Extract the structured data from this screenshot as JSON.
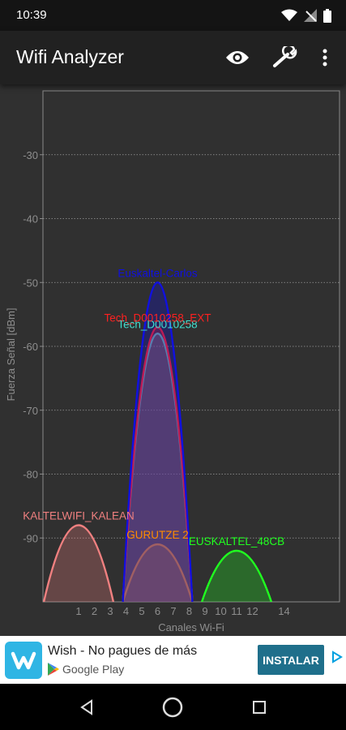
{
  "status_bar": {
    "time": "10:39"
  },
  "app_bar": {
    "title": "Wifi Analyzer",
    "icons": [
      "eye-icon",
      "wrench-icon",
      "more-vert-icon"
    ]
  },
  "chart_data": {
    "type": "area",
    "ylabel": "Fuerza Señal [dBm]",
    "xlabel": "Canales Wi-Fi",
    "ylim": [
      -100,
      -20
    ],
    "yticks": [
      -30,
      -40,
      -50,
      -60,
      -70,
      -80,
      -90
    ],
    "xticks": [
      1,
      2,
      3,
      4,
      5,
      6,
      7,
      8,
      9,
      10,
      11,
      12,
      14
    ],
    "grid": true,
    "networks": [
      {
        "ssid": "KALTELWIFI_KALEAN",
        "channel": 1,
        "signal": -88,
        "color": "#f08080"
      },
      {
        "ssid": "GURUTZE 2",
        "channel": 6,
        "signal": -91,
        "color": "#ff8c00"
      },
      {
        "ssid": "Tech_D0010258",
        "channel": 6,
        "signal": -58,
        "color": "#40e0d0"
      },
      {
        "ssid": "Tech_D0010258_EXT",
        "channel": 6,
        "signal": -57,
        "color": "#ff2020"
      },
      {
        "ssid": "Euskaltel-Carlos",
        "channel": 6,
        "signal": -50,
        "color": "#1010e0"
      },
      {
        "ssid": "EUSKALTEL_48CB",
        "channel": 11,
        "signal": -92,
        "color": "#20ff20"
      }
    ]
  },
  "ad": {
    "title": "Wish - No pagues de más",
    "store": "Google Play",
    "button": "INSTALAR"
  }
}
